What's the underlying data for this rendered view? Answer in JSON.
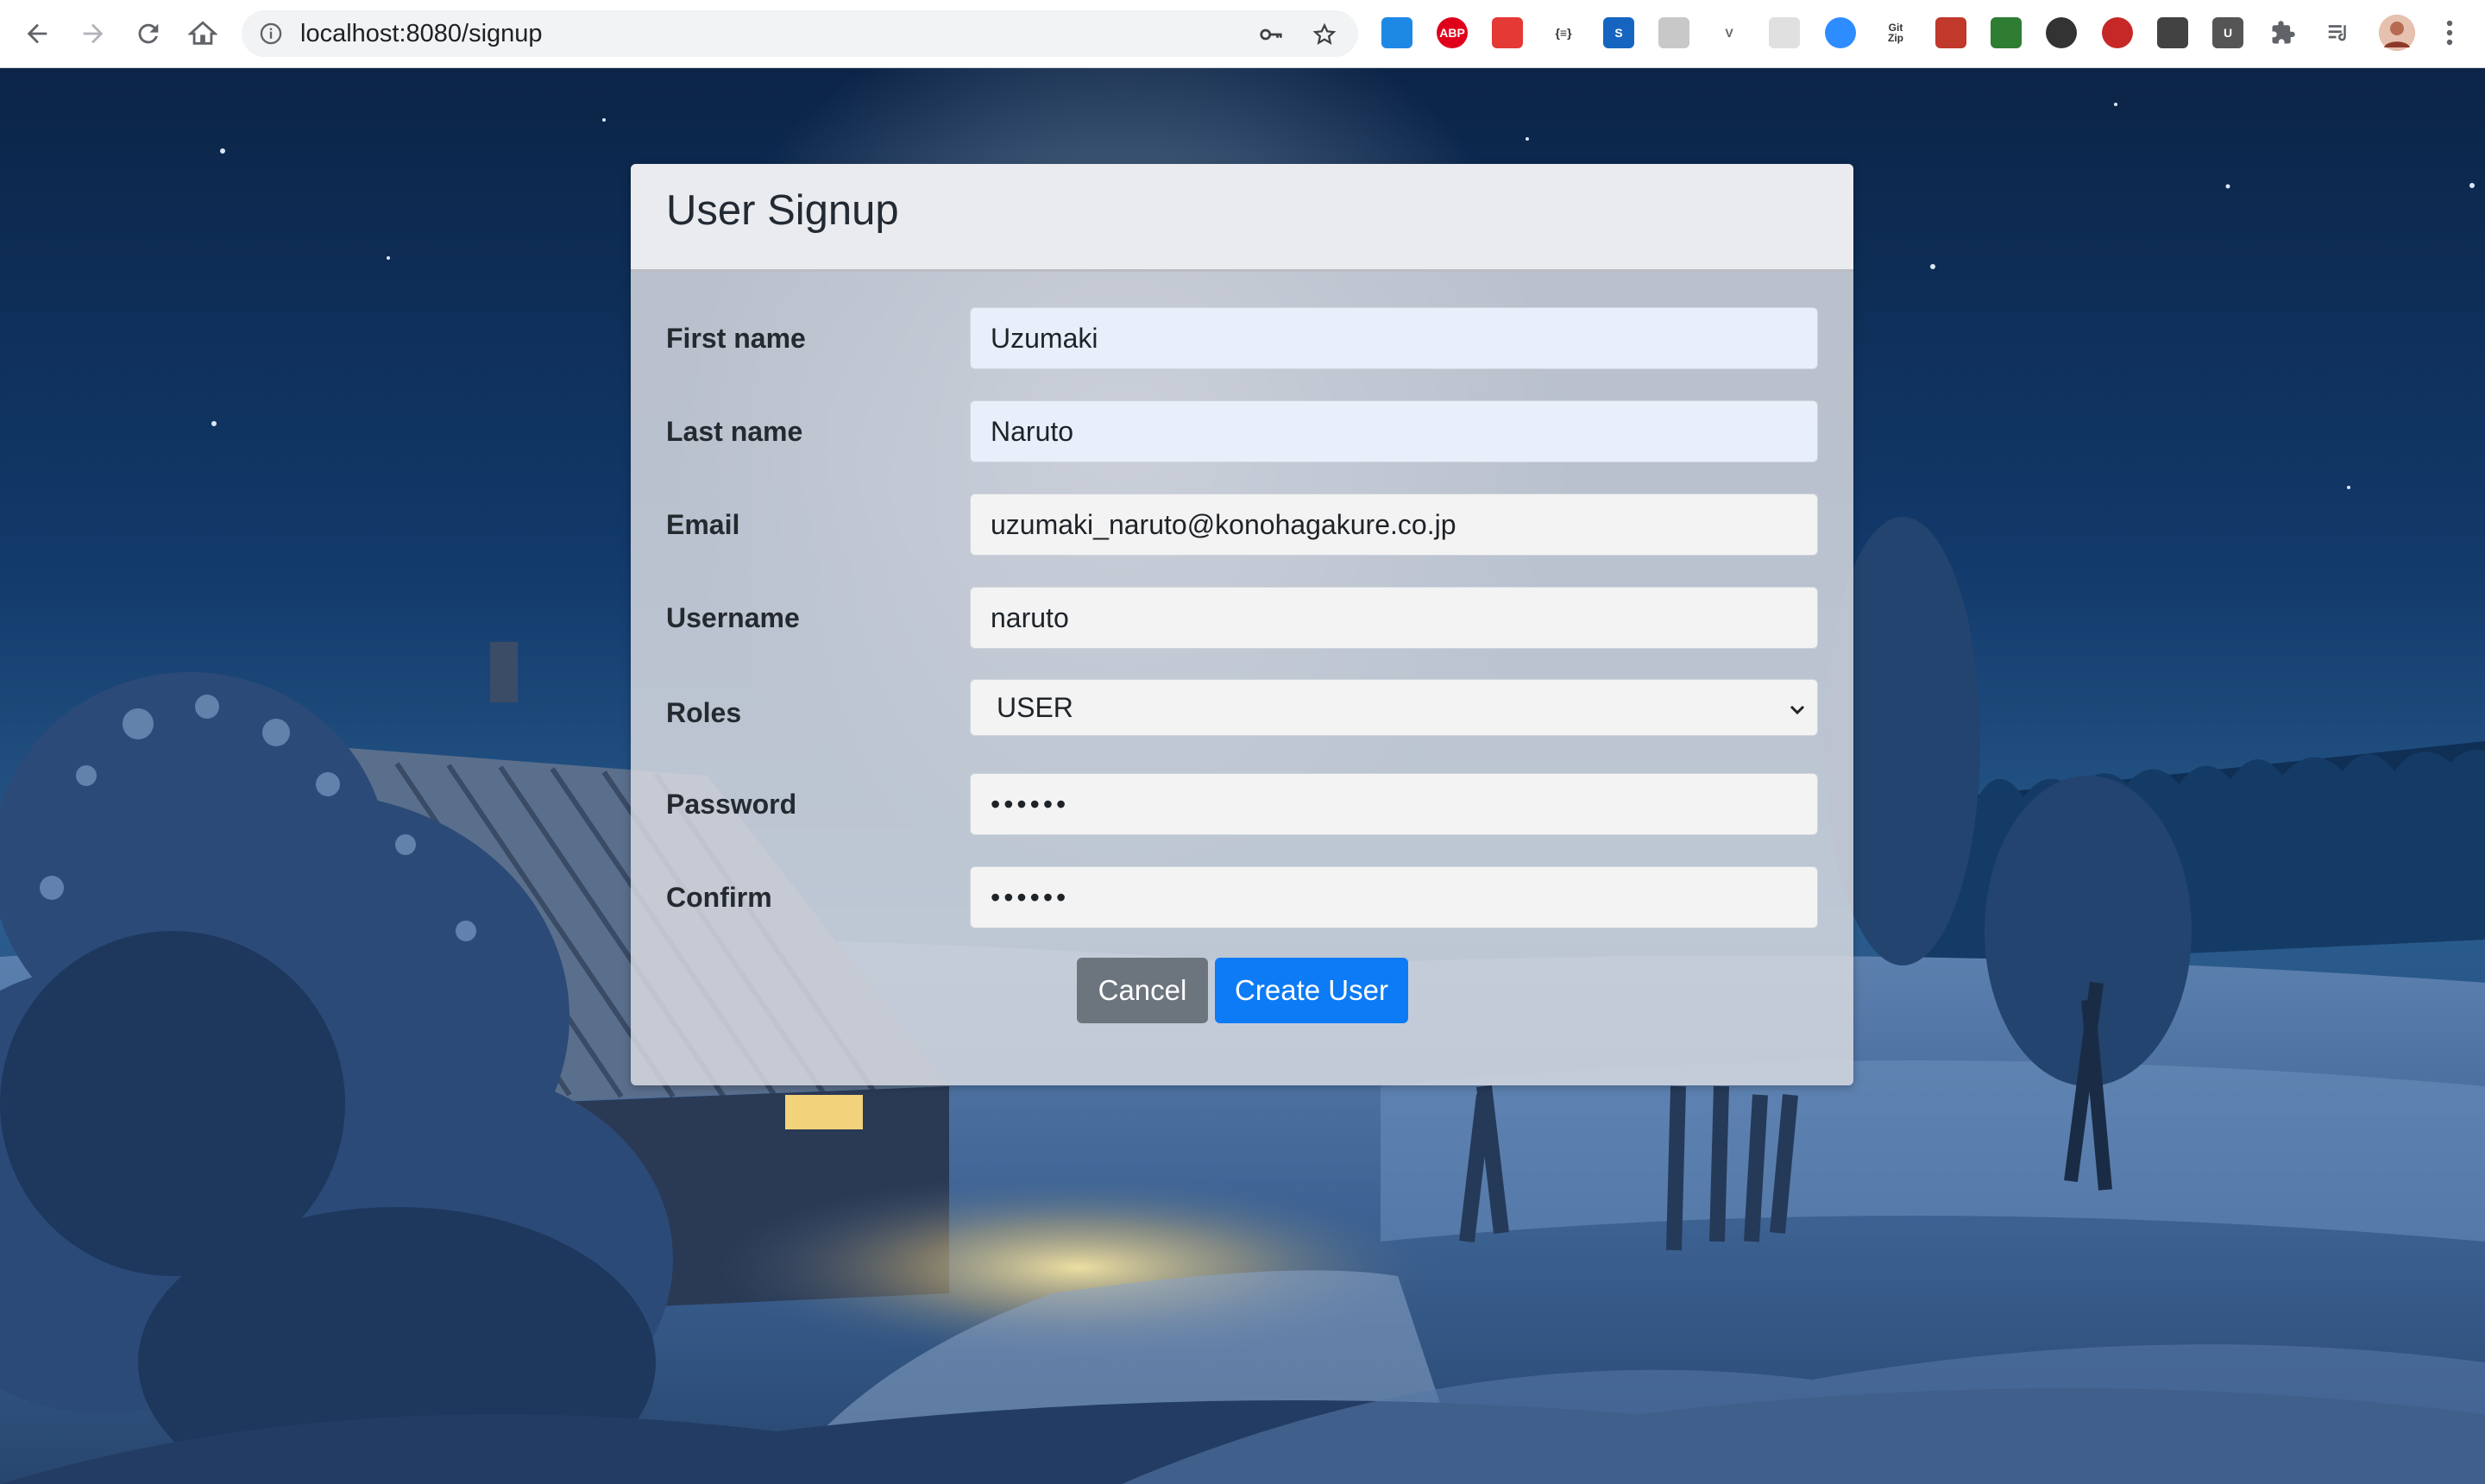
{
  "browser": {
    "url_host": "localhost",
    "url_rest": ":8080/signup",
    "nav_icons": [
      "back-arrow-icon",
      "forward-arrow-icon",
      "reload-icon",
      "home-icon"
    ],
    "omnibox_icons": [
      "info-icon",
      "key-icon",
      "star-icon"
    ],
    "extension_icons": [
      {
        "name": "trello-extension-icon",
        "color": "#1e88e5",
        "text": ""
      },
      {
        "name": "adblock-plus-icon",
        "color": "#e0001b",
        "text": "ABP"
      },
      {
        "name": "network-extension-icon",
        "color": "#e53935",
        "text": ""
      },
      {
        "name": "json-viewer-icon",
        "color": "#333333",
        "text": "{≡}"
      },
      {
        "name": "s-extension-icon",
        "color": "#1565c0",
        "text": "S"
      },
      {
        "name": "faded-extension-icon",
        "color": "#c8c8c8",
        "text": ""
      },
      {
        "name": "vue-devtools-icon",
        "color": "#5f6368",
        "text": "V"
      },
      {
        "name": "grey-square-extension-icon",
        "color": "#e0e0e0",
        "text": ""
      },
      {
        "name": "zoom-extension-icon",
        "color": "#2d8cff",
        "text": ""
      },
      {
        "name": "gitzip-icon",
        "color": "#333333",
        "text": "Git Zip"
      },
      {
        "name": "screenshot-extension-icon",
        "color": "#c0392b",
        "text": ""
      },
      {
        "name": "leaf-extension-icon",
        "color": "#2e7d32",
        "text": ""
      },
      {
        "name": "timer-extension-icon",
        "color": "#333333",
        "text": ""
      },
      {
        "name": "red-circle-extension-icon",
        "color": "#c62828",
        "text": ""
      },
      {
        "name": "gear-extension-icon",
        "color": "#424242",
        "text": ""
      },
      {
        "name": "shield-extension-icon",
        "color": "#555555",
        "text": "U"
      },
      {
        "name": "puzzle-icon",
        "color": "#5f6368",
        "text": ""
      },
      {
        "name": "reading-list-icon",
        "color": "#5f6368",
        "text": ""
      },
      {
        "name": "profile-avatar-icon",
        "color": "#c0705a",
        "text": ""
      },
      {
        "name": "kebab-menu-icon",
        "color": "#5f6368",
        "text": ""
      }
    ]
  },
  "form": {
    "title": "User Signup",
    "fields": [
      {
        "label": "First name",
        "value": "Uzumaki",
        "type": "text"
      },
      {
        "label": "Last name",
        "value": "Naruto",
        "type": "text"
      },
      {
        "label": "Email",
        "value": "uzumaki_naruto@konohagakure.co.jp",
        "type": "text"
      },
      {
        "label": "Username",
        "value": "naruto",
        "type": "text"
      },
      {
        "label": "Roles",
        "value": "USER",
        "type": "select"
      },
      {
        "label": "Password",
        "value": "••••••",
        "type": "password"
      },
      {
        "label": "Confirm",
        "value": "••••••",
        "type": "password"
      }
    ],
    "cancel_label": "Cancel",
    "create_label": "Create User"
  },
  "colors": {
    "primary": "#0d7bf5",
    "secondary": "#6c757d",
    "night_sky": "#0d2d58"
  }
}
